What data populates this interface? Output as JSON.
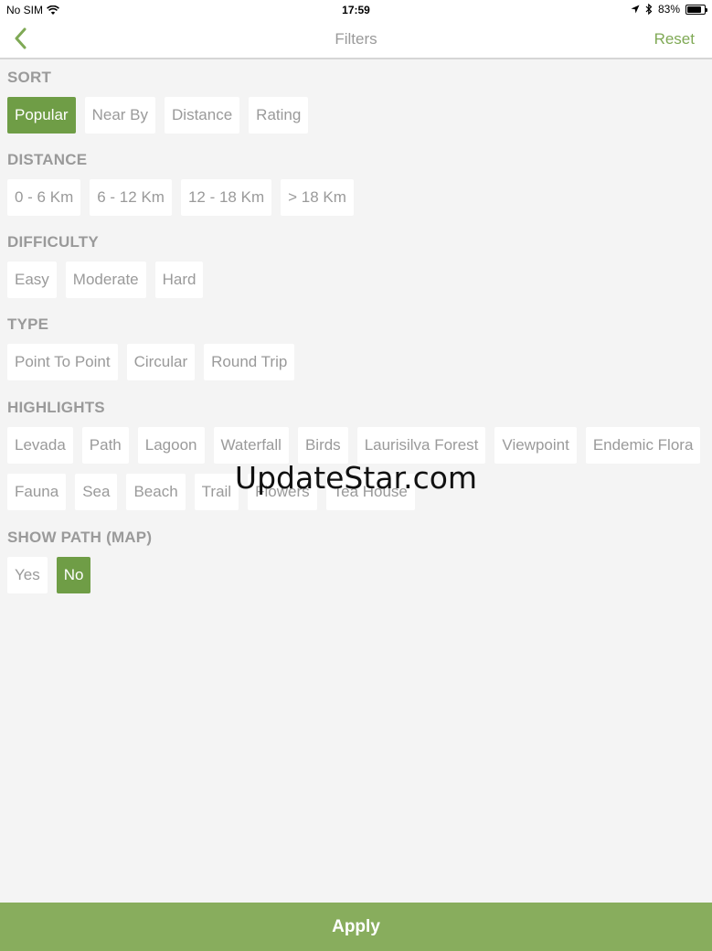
{
  "statusbar": {
    "carrier": "No SIM",
    "time": "17:59",
    "battery": "83%",
    "battery_level": 0.83
  },
  "navbar": {
    "title": "Filters",
    "reset_label": "Reset"
  },
  "sections": {
    "sort": {
      "title": "SORT",
      "options": [
        "Popular",
        "Near By",
        "Distance",
        "Rating"
      ],
      "selected": [
        "Popular"
      ]
    },
    "distance": {
      "title": "DISTANCE",
      "options": [
        "0 - 6 Km",
        "6 - 12 Km",
        "12 - 18 Km",
        "> 18 Km"
      ],
      "selected": []
    },
    "difficulty": {
      "title": "DIFFICULTY",
      "options": [
        "Easy",
        "Moderate",
        "Hard"
      ],
      "selected": []
    },
    "type": {
      "title": "TYPE",
      "options": [
        "Point To Point",
        "Circular",
        "Round Trip"
      ],
      "selected": []
    },
    "highlights": {
      "title": "HIGHLIGHTS",
      "options": [
        "Levada",
        "Path",
        "Lagoon",
        "Waterfall",
        "Birds",
        "Laurisilva Forest",
        "Viewpoint",
        "Endemic Flora",
        "Fauna",
        "Sea",
        "Beach",
        "Trail",
        "Flowers",
        "Tea House"
      ],
      "selected": []
    },
    "show_path": {
      "title": "SHOW PATH (MAP)",
      "options": [
        "Yes",
        "No"
      ],
      "selected": [
        "No"
      ]
    }
  },
  "apply_label": "Apply",
  "watermark": "UpdateStar.com",
  "colors": {
    "accent": "#6f9d46",
    "apply_bar": "#88ad5d",
    "reset_text": "#7fa955"
  }
}
